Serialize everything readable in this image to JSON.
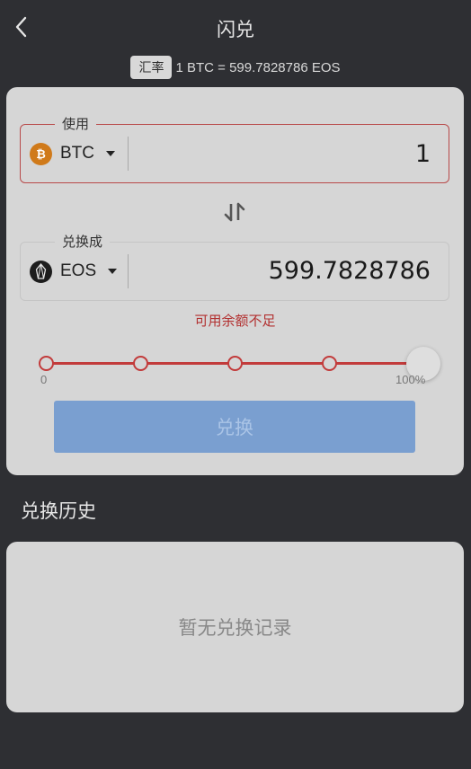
{
  "header": {
    "title": "闪兑"
  },
  "rate": {
    "badge": "汇率",
    "text": "1 BTC = 599.7828786 EOS"
  },
  "from_field": {
    "legend": "使用",
    "coin": "BTC",
    "amount": "1"
  },
  "to_field": {
    "legend": "兑换成",
    "coin": "EOS",
    "amount": "599.7828786"
  },
  "warning": "可用余额不足",
  "slider": {
    "min_label": "0",
    "max_label": "100%",
    "value_fraction": 1.0,
    "steps": [
      0,
      0.25,
      0.5,
      0.75,
      1.0
    ]
  },
  "exchange_button": "兑换",
  "history": {
    "title": "兑换历史",
    "empty": "暂无兑换记录"
  },
  "icons": {
    "back": "chevron-left-icon",
    "btc": "bitcoin-icon",
    "eos": "eos-icon",
    "swap": "swap-arrows-icon",
    "caret": "caret-down-icon"
  },
  "colors": {
    "accent_red": "#c23b3b",
    "button_blue": "#7a9fd0",
    "btc_orange": "#d07a1a",
    "background": "#2e2f33",
    "card": "#d6d6d6"
  }
}
